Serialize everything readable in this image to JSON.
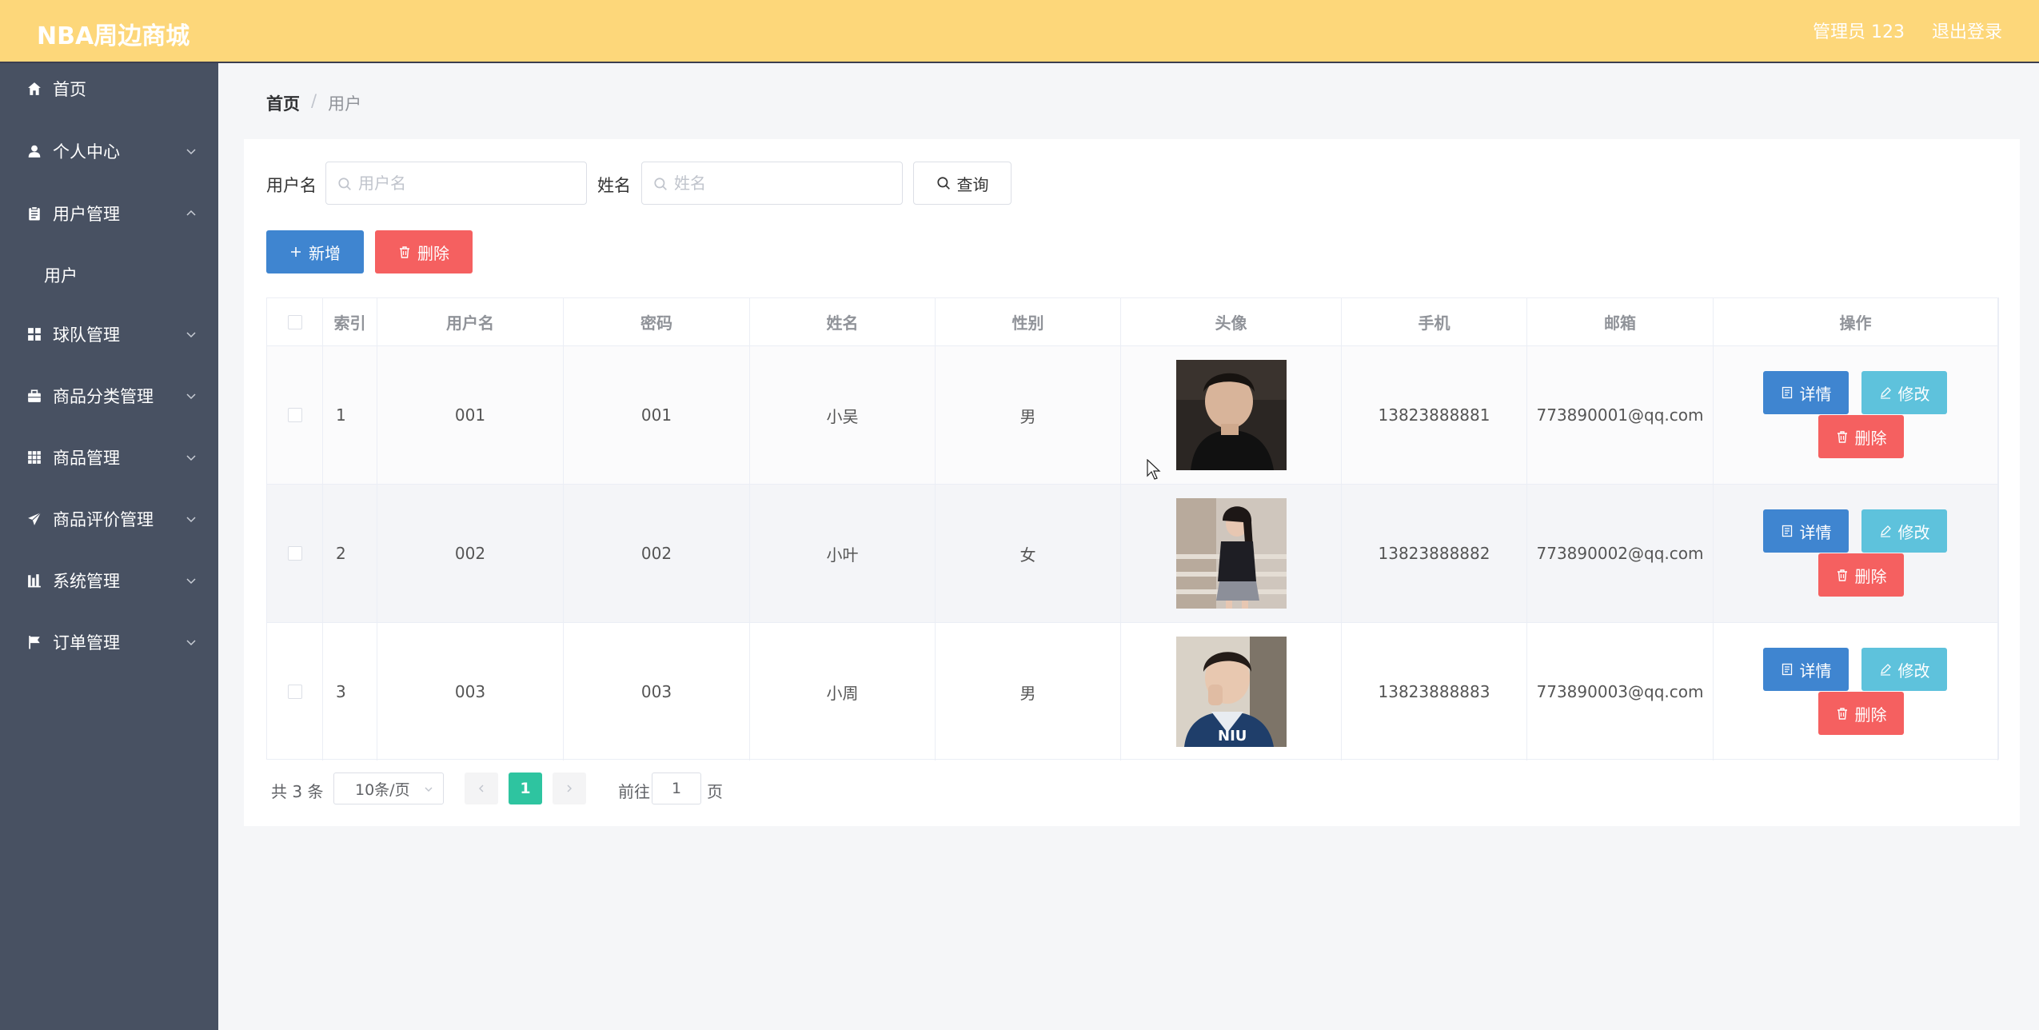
{
  "header": {
    "brand": "NBA周边商城",
    "user_label": "管理员 123",
    "logout_label": "退出登录",
    "bg_color": "#fdd77a"
  },
  "sidebar": {
    "bg_color": "#485162",
    "items": [
      {
        "label": "首页",
        "icon": "home-icon",
        "has_chevron": false
      },
      {
        "label": "个人中心",
        "icon": "person-icon",
        "has_chevron": true,
        "expanded": false
      },
      {
        "label": "用户管理",
        "icon": "clipboard-icon",
        "has_chevron": true,
        "expanded": true
      },
      {
        "label": "用户",
        "sub": true
      },
      {
        "label": "球队管理",
        "icon": "grid-icon",
        "has_chevron": true,
        "expanded": false
      },
      {
        "label": "商品分类管理",
        "icon": "briefcase-icon",
        "has_chevron": true,
        "expanded": false
      },
      {
        "label": "商品管理",
        "icon": "apps-icon",
        "has_chevron": true,
        "expanded": false
      },
      {
        "label": "商品评价管理",
        "icon": "send-icon",
        "has_chevron": true,
        "expanded": false
      },
      {
        "label": "系统管理",
        "icon": "bar-icon",
        "has_chevron": true,
        "expanded": false
      },
      {
        "label": "订单管理",
        "icon": "flag-icon",
        "has_chevron": true,
        "expanded": false
      }
    ]
  },
  "breadcrumb": {
    "home": "首页",
    "separator": "/",
    "current": "用户"
  },
  "search": {
    "username_label": "用户名",
    "username_placeholder": "用户名",
    "username_value": "",
    "name_label": "姓名",
    "name_placeholder": "姓名",
    "name_value": "",
    "query_label": "查询"
  },
  "actions": {
    "add_label": "新增",
    "delete_label": "删除"
  },
  "table": {
    "headers": [
      "索引",
      "用户名",
      "密码",
      "姓名",
      "性别",
      "头像",
      "手机",
      "邮箱",
      "操作"
    ],
    "rows": [
      {
        "index": "1",
        "username": "001",
        "password": "001",
        "name": "小吴",
        "gender": "男",
        "phone": "13823888881",
        "email": "773890001@qq.com",
        "avatar": "avatar-male-dark-shirt"
      },
      {
        "index": "2",
        "username": "002",
        "password": "002",
        "name": "小叶",
        "gender": "女",
        "phone": "13823888882",
        "email": "773890002@qq.com",
        "avatar": "avatar-female-stairs"
      },
      {
        "index": "3",
        "username": "003",
        "password": "003",
        "name": "小周",
        "gender": "男",
        "phone": "13823888883",
        "email": "773890003@qq.com",
        "avatar": "avatar-male-car"
      }
    ],
    "row_actions": {
      "detail_label": "详情",
      "edit_label": "修改",
      "delete_label": "删除"
    }
  },
  "pagination": {
    "total_text": "共 3 条",
    "page_size": "10条/页",
    "current_page": "1",
    "goto_label": "前往",
    "goto_value": "1",
    "page_suffix": "页"
  },
  "colors": {
    "primary_blue": "#3f85d0",
    "danger_red": "#f56060",
    "info_cyan": "#5ec2dc",
    "pager_active": "#2ec4a0"
  }
}
